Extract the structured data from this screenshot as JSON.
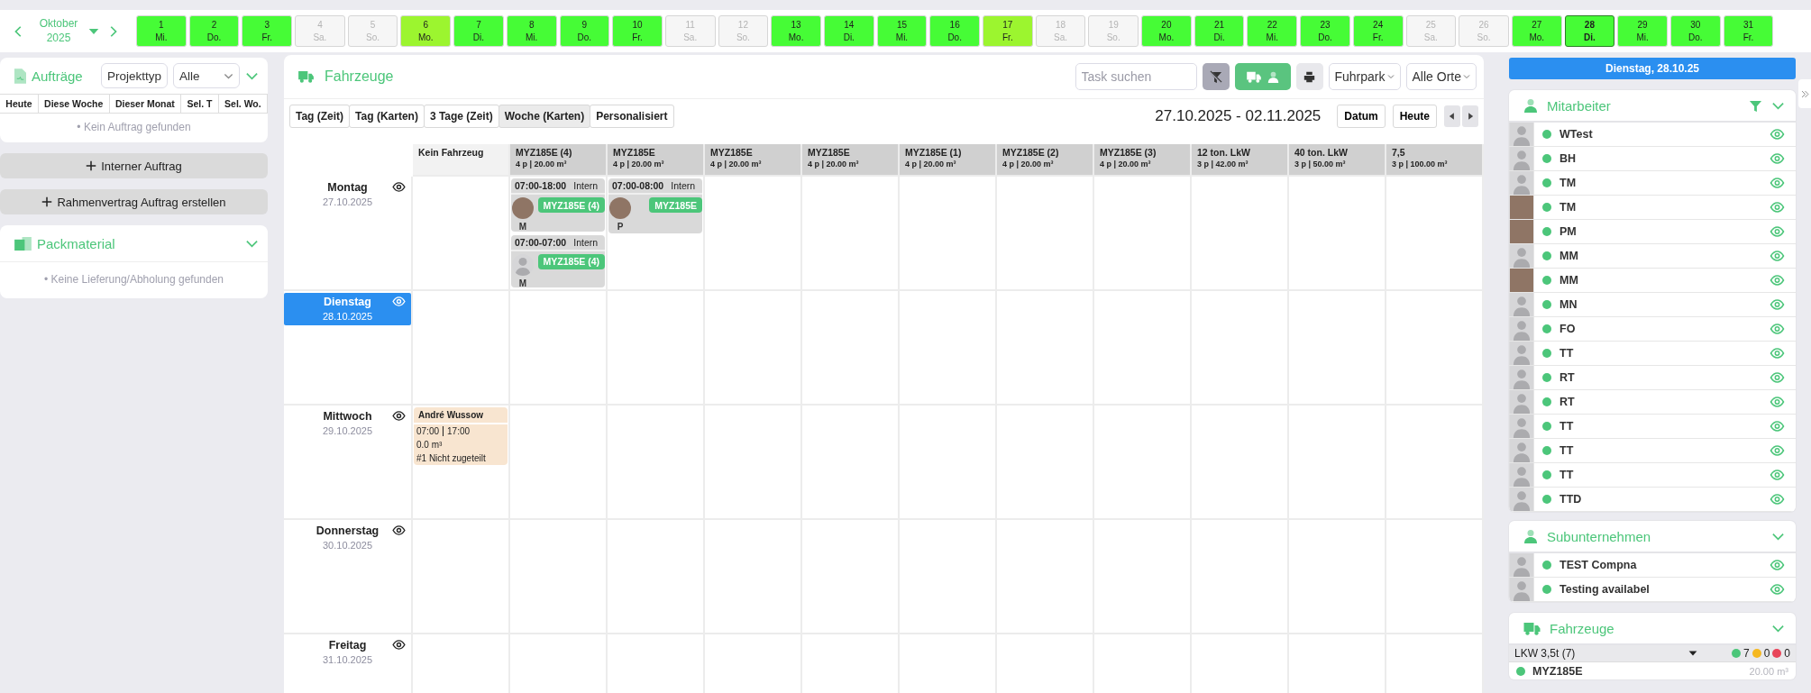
{
  "calendar": {
    "month": "Oktober",
    "year": "2025",
    "days": [
      {
        "day": "1",
        "weekday": "Mi.",
        "kind": "work",
        "selected": false
      },
      {
        "day": "2",
        "weekday": "Do.",
        "kind": "work",
        "selected": false
      },
      {
        "day": "3",
        "weekday": "Fr.",
        "kind": "work",
        "selected": false
      },
      {
        "day": "4",
        "weekday": "Sa.",
        "kind": "off",
        "selected": false
      },
      {
        "day": "5",
        "weekday": "So.",
        "kind": "off",
        "selected": false
      },
      {
        "day": "6",
        "weekday": "Mo.",
        "kind": "partial",
        "selected": false
      },
      {
        "day": "7",
        "weekday": "Di.",
        "kind": "work",
        "selected": false
      },
      {
        "day": "8",
        "weekday": "Mi.",
        "kind": "work",
        "selected": false
      },
      {
        "day": "9",
        "weekday": "Do.",
        "kind": "work",
        "selected": false
      },
      {
        "day": "10",
        "weekday": "Fr.",
        "kind": "work",
        "selected": false
      },
      {
        "day": "11",
        "weekday": "Sa.",
        "kind": "off",
        "selected": false
      },
      {
        "day": "12",
        "weekday": "So.",
        "kind": "off",
        "selected": false
      },
      {
        "day": "13",
        "weekday": "Mo.",
        "kind": "work",
        "selected": false
      },
      {
        "day": "14",
        "weekday": "Di.",
        "kind": "work",
        "selected": false
      },
      {
        "day": "15",
        "weekday": "Mi.",
        "kind": "work",
        "selected": false
      },
      {
        "day": "16",
        "weekday": "Do.",
        "kind": "work",
        "selected": false
      },
      {
        "day": "17",
        "weekday": "Fr.",
        "kind": "partial",
        "selected": false
      },
      {
        "day": "18",
        "weekday": "Sa.",
        "kind": "off",
        "selected": false
      },
      {
        "day": "19",
        "weekday": "So.",
        "kind": "off",
        "selected": false
      },
      {
        "day": "20",
        "weekday": "Mo.",
        "kind": "work",
        "selected": false
      },
      {
        "day": "21",
        "weekday": "Di.",
        "kind": "work",
        "selected": false
      },
      {
        "day": "22",
        "weekday": "Mi.",
        "kind": "work",
        "selected": false
      },
      {
        "day": "23",
        "weekday": "Do.",
        "kind": "work",
        "selected": false
      },
      {
        "day": "24",
        "weekday": "Fr.",
        "kind": "work",
        "selected": false
      },
      {
        "day": "25",
        "weekday": "Sa.",
        "kind": "off",
        "selected": false
      },
      {
        "day": "26",
        "weekday": "So.",
        "kind": "off",
        "selected": false
      },
      {
        "day": "27",
        "weekday": "Mo.",
        "kind": "work",
        "selected": false
      },
      {
        "day": "28",
        "weekday": "Di.",
        "kind": "work",
        "selected": true
      },
      {
        "day": "29",
        "weekday": "Mi.",
        "kind": "work",
        "selected": false
      },
      {
        "day": "30",
        "weekday": "Do.",
        "kind": "work",
        "selected": false
      },
      {
        "day": "31",
        "weekday": "Fr.",
        "kind": "work",
        "selected": false
      }
    ]
  },
  "orders": {
    "title": "Aufträge",
    "project_type": "Projekttyp",
    "filter": "Alle",
    "tabs": [
      {
        "label": "Heute",
        "selected": false
      },
      {
        "label": "Diese Woche",
        "selected": false
      },
      {
        "label": "Dieser Monat",
        "selected": false
      },
      {
        "label": "Sel. T",
        "selected": false
      },
      {
        "label": "Sel. Wo.",
        "selected": false
      }
    ],
    "empty": "• Kein Auftrag gefunden"
  },
  "order_buttons": [
    "Interner Auftrag",
    "Rahmenvertrag Auftrag erstellen"
  ],
  "packmaterial": {
    "title": "Packmaterial",
    "empty": "• Keine Lieferung/Abholung gefunden"
  },
  "planner": {
    "title": "Fahrzeuge",
    "search_placeholder": "Task suchen",
    "fleet": "Fuhrpark",
    "locations": "Alle Orte",
    "views": [
      {
        "label": "Tag (Zeit)",
        "selected": false
      },
      {
        "label": "Tag (Karten)",
        "selected": false
      },
      {
        "label": "3 Tage (Zeit)",
        "selected": false
      },
      {
        "label": "Woche (Karten)",
        "selected": true
      },
      {
        "label": "Personalisiert",
        "selected": false
      }
    ],
    "range": "27.10.2025 - 02.11.2025",
    "date_button": "Datum",
    "today_button": "Heute",
    "columns": [
      {
        "name": "Kein Fahrzeug"
      },
      {
        "name": "MYZ185E (4)",
        "capacity": "4 p | 20.00 m³"
      },
      {
        "name": "MYZ185E",
        "capacity": "4 p | 20.00 m³"
      },
      {
        "name": "MYZ185E",
        "capacity": "4 p | 20.00 m³"
      },
      {
        "name": "MYZ185E",
        "capacity": "4 p | 20.00 m³"
      },
      {
        "name": "MYZ185E (1)",
        "capacity": "4 p | 20.00 m³"
      },
      {
        "name": "MYZ185E (2)",
        "capacity": "4 p | 20.00 m³"
      },
      {
        "name": "MYZ185E (3)",
        "capacity": "4 p | 20.00 m³"
      },
      {
        "name": "12 ton. LkW",
        "capacity": "3 p | 42.00 m³"
      },
      {
        "name": "40 ton. LkW",
        "capacity": "3 p | 50.00 m³"
      },
      {
        "name": "7,5",
        "capacity": "3 p | 100.00 m³"
      }
    ],
    "rows": [
      {
        "day": "Montag",
        "date": "27.10.2025",
        "selected": false,
        "cells": [
          {},
          {
            "tasks": [
              {
                "kind": "assignment",
                "time": "07:00-18:00",
                "type": "Intern",
                "photo": true,
                "vehicle": "MYZ185E (4)",
                "initial": "M"
              },
              {
                "kind": "assignment",
                "time": "07:00-07:00",
                "type": "Intern",
                "photo": false,
                "vehicle": "MYZ185E (4)",
                "initial": "M"
              }
            ]
          },
          {
            "tasks": [
              {
                "kind": "assignment",
                "time": "07:00-08:00",
                "type": "Intern",
                "photo": true,
                "vehicle": "MYZ185E",
                "initial": "P"
              }
            ]
          },
          {},
          {},
          {},
          {},
          {},
          {},
          {},
          {}
        ]
      },
      {
        "day": "Dienstag",
        "date": "28.10.2025",
        "selected": true,
        "cells": [
          {},
          {},
          {},
          {},
          {},
          {},
          {},
          {},
          {},
          {},
          {}
        ]
      },
      {
        "day": "Mittwoch",
        "date": "29.10.2025",
        "selected": false,
        "cells": [
          {
            "tasks": [
              {
                "kind": "order",
                "name": "André Wussow",
                "time_start": "07:00",
                "time_end": "17:00",
                "volume": "0.0 m³",
                "status": "#1 Nicht zugeteilt"
              }
            ]
          },
          {},
          {},
          {},
          {},
          {},
          {},
          {},
          {},
          {},
          {}
        ]
      },
      {
        "day": "Donnerstag",
        "date": "30.10.2025",
        "selected": false,
        "cells": [
          {},
          {},
          {},
          {},
          {},
          {},
          {},
          {},
          {},
          {},
          {}
        ]
      },
      {
        "day": "Freitag",
        "date": "31.10.2025",
        "selected": false,
        "cells": [
          {},
          {},
          {},
          {},
          {},
          {},
          {},
          {},
          {},
          {},
          {}
        ]
      }
    ]
  },
  "selected_date": "Dienstag, 28.10.25",
  "employees": {
    "title": "Mitarbeiter",
    "items": [
      {
        "name": "WTest",
        "photo": false,
        "available": true
      },
      {
        "name": "BH",
        "photo": false,
        "available": true
      },
      {
        "name": "TM",
        "photo": false,
        "available": true
      },
      {
        "name": "TM",
        "photo": true,
        "available": true
      },
      {
        "name": "PM",
        "photo": true,
        "available": true
      },
      {
        "name": "MM",
        "photo": false,
        "available": true
      },
      {
        "name": "MM",
        "photo": true,
        "available": true
      },
      {
        "name": "MN",
        "photo": false,
        "available": true
      },
      {
        "name": "FO",
        "photo": false,
        "available": true
      },
      {
        "name": "TT",
        "photo": false,
        "available": true
      },
      {
        "name": "RT",
        "photo": false,
        "available": true
      },
      {
        "name": "RT",
        "photo": false,
        "available": true
      },
      {
        "name": "TT",
        "photo": false,
        "available": true
      },
      {
        "name": "TT",
        "photo": false,
        "available": true
      },
      {
        "name": "TT",
        "photo": false,
        "available": true
      },
      {
        "name": "TTD",
        "photo": false,
        "available": true
      }
    ]
  },
  "subcontractors": {
    "title": "Subunternehmen",
    "items": [
      {
        "name": "TEST Compna",
        "photo": false,
        "available": true
      },
      {
        "name": "Testing availabel",
        "photo": false,
        "available": true
      }
    ]
  },
  "vehicles": {
    "title": "Fahrzeuge",
    "group": {
      "label": "LKW 3,5t (7)",
      "counts": [
        {
          "value": "7",
          "color": "#4cc67a"
        },
        {
          "value": "0",
          "color": "#f5b820"
        },
        {
          "value": "0",
          "color": "#e8455a"
        }
      ]
    },
    "items": [
      {
        "name": "MYZ185E",
        "capacity": "20.00 m³",
        "available": true
      }
    ]
  }
}
